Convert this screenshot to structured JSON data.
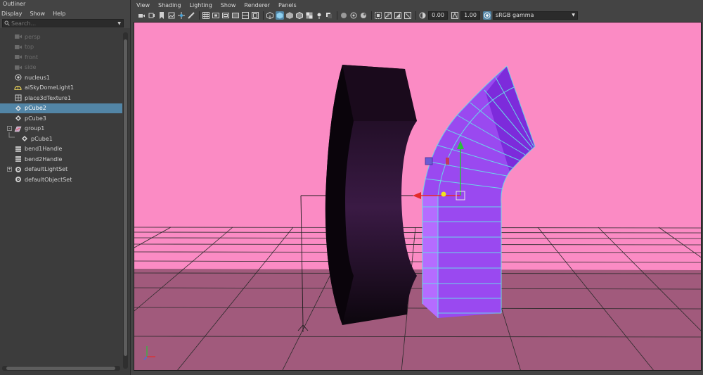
{
  "outliner": {
    "title": "Outliner",
    "menu": [
      "Display",
      "Show",
      "Help"
    ],
    "search_placeholder": "Search...",
    "items": [
      {
        "label": "persp",
        "icon": "camera-icon",
        "dim": true,
        "selected": false,
        "indent": 0
      },
      {
        "label": "top",
        "icon": "camera-icon",
        "dim": true,
        "selected": false,
        "indent": 0
      },
      {
        "label": "front",
        "icon": "camera-icon",
        "dim": true,
        "selected": false,
        "indent": 0
      },
      {
        "label": "side",
        "icon": "camera-icon",
        "dim": true,
        "selected": false,
        "indent": 0
      },
      {
        "label": "nucleus1",
        "icon": "nucleus-icon",
        "dim": false,
        "selected": false,
        "indent": 0
      },
      {
        "label": "aiSkyDomeLight1",
        "icon": "skydome-light-icon",
        "dim": false,
        "selected": false,
        "indent": 0
      },
      {
        "label": "place3dTexture1",
        "icon": "place3d-texture-icon",
        "dim": false,
        "selected": false,
        "indent": 0
      },
      {
        "label": "pCube2",
        "icon": "mesh-icon",
        "dim": false,
        "selected": true,
        "indent": 0
      },
      {
        "label": "pCube3",
        "icon": "mesh-icon",
        "dim": false,
        "selected": false,
        "indent": 0
      },
      {
        "label": "group1",
        "icon": "group-icon",
        "dim": false,
        "selected": false,
        "indent": 0,
        "expander": "-"
      },
      {
        "label": "pCube1",
        "icon": "mesh-icon",
        "dim": false,
        "selected": false,
        "indent": 1
      },
      {
        "label": "bend1Handle",
        "icon": "deformer-handle-icon",
        "dim": false,
        "selected": false,
        "indent": 0
      },
      {
        "label": "bend2Handle",
        "icon": "deformer-handle-icon",
        "dim": false,
        "selected": false,
        "indent": 0
      },
      {
        "label": "defaultLightSet",
        "icon": "set-icon",
        "dim": false,
        "selected": false,
        "indent": 0,
        "expander": "+"
      },
      {
        "label": "defaultObjectSet",
        "icon": "set-icon",
        "dim": false,
        "selected": false,
        "indent": 0
      }
    ]
  },
  "panel": {
    "menu": [
      "View",
      "Shading",
      "Lighting",
      "Show",
      "Renderer",
      "Panels"
    ],
    "exposure_value": "0.00",
    "gamma_value": "1.00",
    "color_space": "sRGB gamma"
  },
  "colors": {
    "background": "#fb8bc4",
    "floor": "#a15a7c",
    "selected_row": "#5285a6",
    "mesh_purple": "#9a49f0",
    "wireframe": "#6ad7e8"
  }
}
